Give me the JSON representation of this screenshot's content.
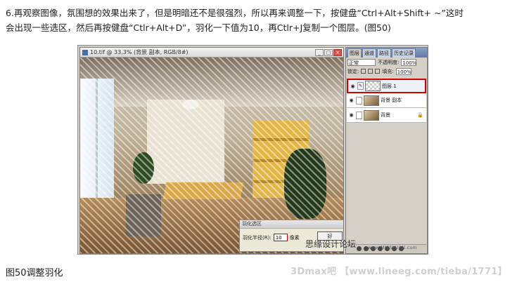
{
  "article": {
    "line1": "6.再观察图像，氛围想的效果出来了，但是明暗还不是很强烈，所以再来调整一下，按健盘“Ctrl+Alt+Shift+ ~”这时",
    "line2": "会出现一些选区，然后再按健盘“Ctlr+Alt+D”，羽化一下值为10，再Ctlr+J复制一个图层。(图50)",
    "caption": "图50调整羽化"
  },
  "document": {
    "title": "10.tif @ 33.3% (背景 副本, RGB/8#)",
    "btn_min": "_",
    "btn_max": "□",
    "btn_close": "×"
  },
  "feather_dialog": {
    "title": "羽化选区",
    "radius_label": "羽化半径(R):",
    "radius_value": "10",
    "unit": "像素",
    "ok_label": "好"
  },
  "layers_panel": {
    "tabs": [
      "图层",
      "通道",
      "路径",
      "历史记录"
    ],
    "blend_mode": "正常",
    "opacity_label": "不透明度:",
    "opacity_value": "100%",
    "lock_label": "锁定:",
    "fill_label": "填充:",
    "fill_value": "100%",
    "layers": [
      {
        "name": "图层 1",
        "selected": true
      },
      {
        "name": "背景 副本",
        "selected": false
      },
      {
        "name": "背景",
        "selected": false,
        "locked": true
      }
    ]
  },
  "watermarks": {
    "site_cn": "思缘设计论坛",
    "site_url": "www.MISSYUAN.com",
    "bottom": "3Dmax吧  【www.lineeg.com/tieba/1771】"
  },
  "colors": {
    "selection_highlight": "#d40000"
  }
}
